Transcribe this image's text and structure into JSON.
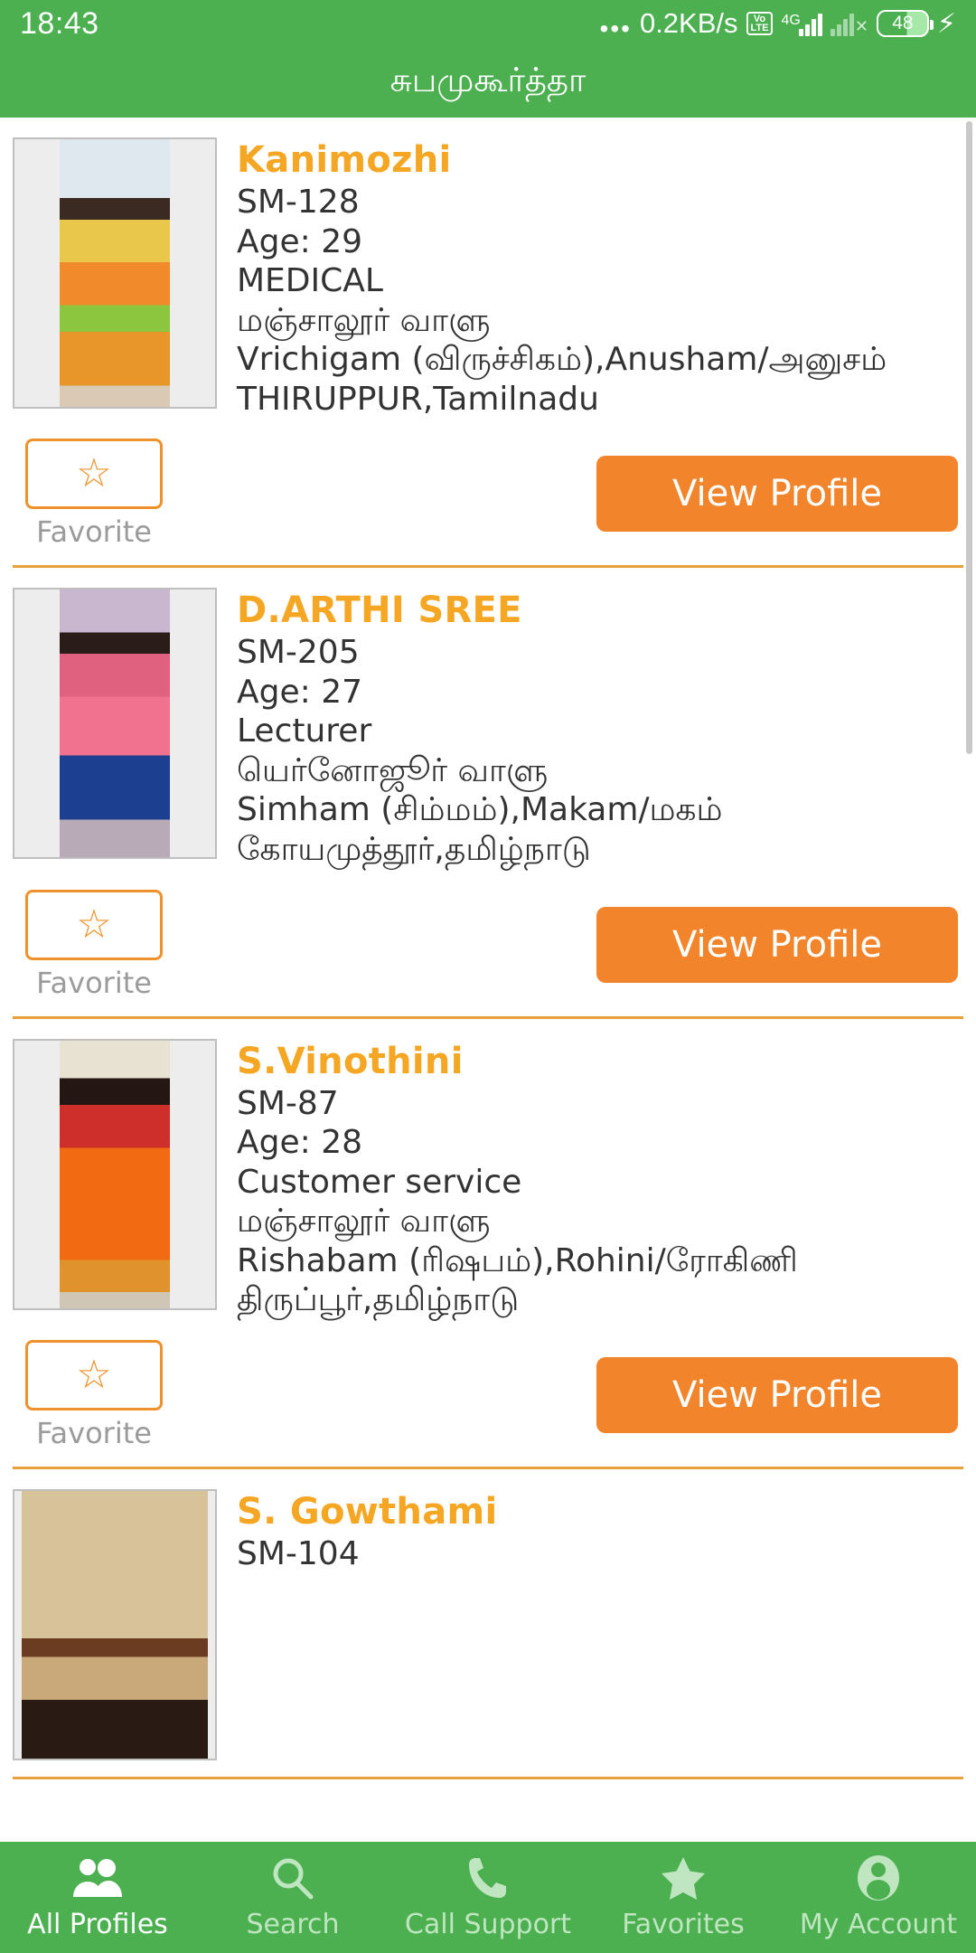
{
  "status_bar": {
    "time": "18:43",
    "dots": "•••",
    "net_speed": "0.2KB/s",
    "volte_top": "Vo",
    "volte_bottom": "LTE",
    "network_type": "4G",
    "battery_level": "48",
    "charging_icon": "bolt-icon"
  },
  "app_bar": {
    "title": "சுபமுகூர்த்தா"
  },
  "colors": {
    "brand_green": "#4CAF50",
    "accent_orange": "#F2852C",
    "name_orange": "#F5A623",
    "divider_orange": "#E8A13A"
  },
  "profiles": [
    {
      "name": "Kanimozhi",
      "id": "SM-128",
      "age": "Age: 29",
      "occupation": "MEDICAL",
      "community": "மஞ்சாலூர் வாளு",
      "rasi_star": "Vrichigam (விருச்சிகம்),Anusham/அனுசம்",
      "location": "THIRUPPUR,Tamilnadu",
      "favorite_label": "Favorite",
      "view_label": "View Profile",
      "favorite_icon": "star-outline-icon"
    },
    {
      "name": "D.ARTHI SREE",
      "id": "SM-205",
      "age": "Age: 27",
      "occupation": "Lecturer",
      "community": "யெர்னோஜூர் வாளு",
      "rasi_star": "Simham (சிம்மம்),Makam/மகம்",
      "location": "கோயமுத்தூர்,தமிழ்நாடு",
      "favorite_label": "Favorite",
      "view_label": "View Profile",
      "favorite_icon": "star-outline-icon"
    },
    {
      "name": "S.Vinothini",
      "id": "SM-87",
      "age": "Age: 28",
      "occupation": "Customer service",
      "community": "மஞ்சாலூர் வாளு",
      "rasi_star": "Rishabam (ரிஷபம்),Rohini/ரோகிணி",
      "location": "திருப்பூர்,தமிழ்நாடு",
      "favorite_label": "Favorite",
      "view_label": "View Profile",
      "favorite_icon": "star-outline-icon"
    },
    {
      "name": "S. Gowthami",
      "id": "SM-104",
      "age": "",
      "occupation": "",
      "community": "",
      "rasi_star": "",
      "location": "",
      "favorite_label": "",
      "view_label": "",
      "favorite_icon": "star-outline-icon"
    }
  ],
  "bottom_nav": [
    {
      "label": "All Profiles",
      "icon": "people-icon",
      "active": true
    },
    {
      "label": "Search",
      "icon": "search-icon",
      "active": false
    },
    {
      "label": "Call Support",
      "icon": "phone-icon",
      "active": false
    },
    {
      "label": "Favorites",
      "icon": "star-filled-icon",
      "active": false
    },
    {
      "label": "My Account",
      "icon": "account-icon",
      "active": false
    }
  ]
}
